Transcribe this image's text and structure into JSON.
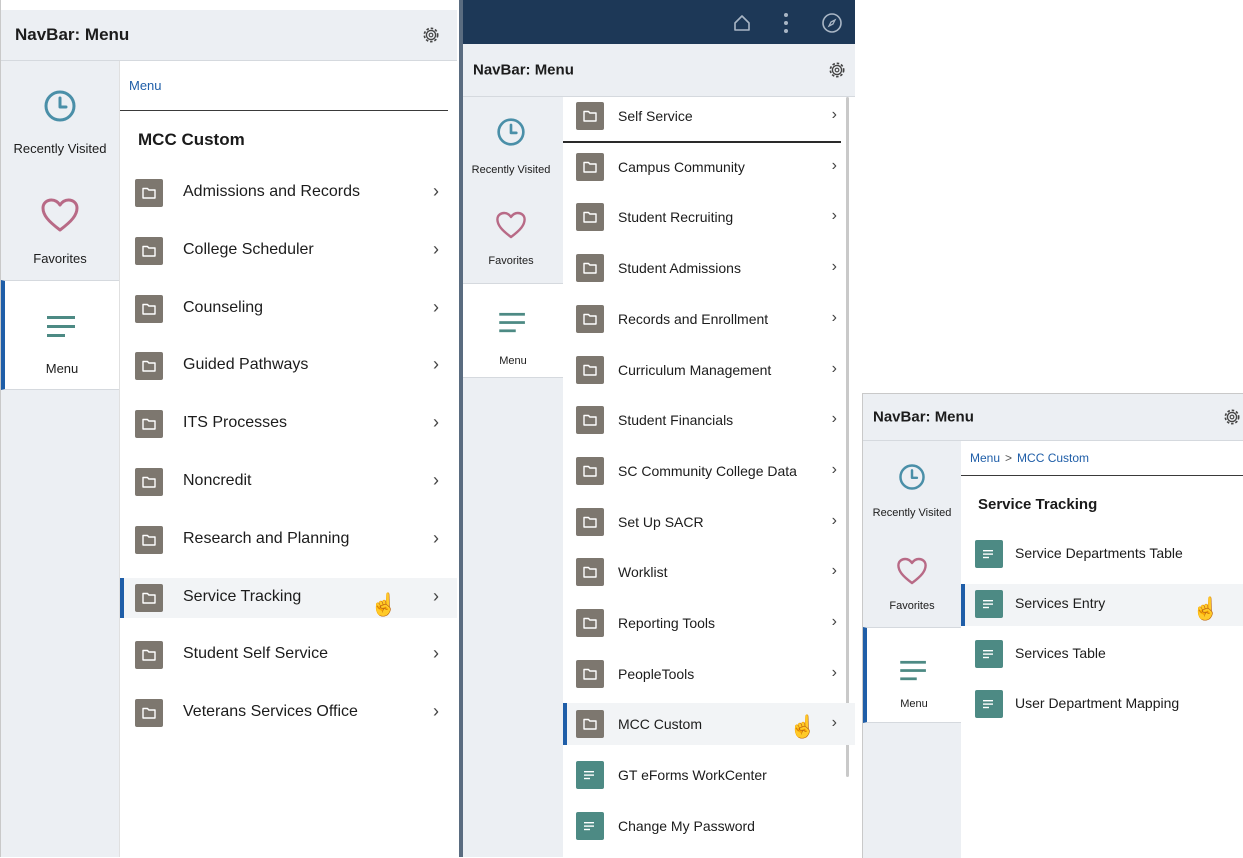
{
  "panel1": {
    "title": "NavBar: Menu",
    "tabs": [
      {
        "label": "Recently Visited",
        "icon": "clock-icon"
      },
      {
        "label": "Favorites",
        "icon": "heart-icon"
      },
      {
        "label": "Menu",
        "icon": "menu-lines-icon"
      }
    ],
    "breadcrumb": "Menu",
    "section_title": "MCC Custom",
    "items": [
      {
        "label": "Admissions and Records"
      },
      {
        "label": "College Scheduler"
      },
      {
        "label": "Counseling"
      },
      {
        "label": "Guided Pathways"
      },
      {
        "label": "ITS Processes"
      },
      {
        "label": "Noncredit"
      },
      {
        "label": "Research and Planning"
      },
      {
        "label": "Service Tracking"
      },
      {
        "label": "Student Self Service"
      },
      {
        "label": "Veterans Services Office"
      }
    ]
  },
  "panel2": {
    "title": "NavBar: Menu",
    "tabs": [
      {
        "label": "Recently Visited"
      },
      {
        "label": "Favorites"
      },
      {
        "label": "Menu"
      }
    ],
    "items": [
      {
        "label": "Self Service",
        "type": "folder"
      },
      {
        "label": "Campus Community",
        "type": "folder"
      },
      {
        "label": "Student Recruiting",
        "type": "folder"
      },
      {
        "label": "Student Admissions",
        "type": "folder"
      },
      {
        "label": "Records and Enrollment",
        "type": "folder"
      },
      {
        "label": "Curriculum Management",
        "type": "folder"
      },
      {
        "label": "Student Financials",
        "type": "folder"
      },
      {
        "label": "SC Community College Data",
        "type": "folder"
      },
      {
        "label": "Set Up SACR",
        "type": "folder"
      },
      {
        "label": "Worklist",
        "type": "folder"
      },
      {
        "label": "Reporting Tools",
        "type": "folder"
      },
      {
        "label": "PeopleTools",
        "type": "folder"
      },
      {
        "label": "MCC Custom",
        "type": "folder"
      },
      {
        "label": "GT eForms WorkCenter",
        "type": "page"
      },
      {
        "label": "Change My Password",
        "type": "page"
      }
    ]
  },
  "panel3": {
    "title": "NavBar: Menu",
    "tabs": [
      {
        "label": "Recently Visited"
      },
      {
        "label": "Favorites"
      },
      {
        "label": "Menu"
      }
    ],
    "breadcrumb": {
      "root": "Menu",
      "separator": ">",
      "current": "MCC Custom"
    },
    "section_title": "Service Tracking",
    "items": [
      {
        "label": "Service Departments Table"
      },
      {
        "label": "Services Entry"
      },
      {
        "label": "Services Table"
      },
      {
        "label": "User Department Mapping"
      }
    ]
  },
  "colors": {
    "accent": "#1f5ea8",
    "folder_icon": "#7d776f",
    "page_icon": "#4d8a84",
    "header_bg": "#eceff3",
    "top_bar": "#1d3857"
  }
}
